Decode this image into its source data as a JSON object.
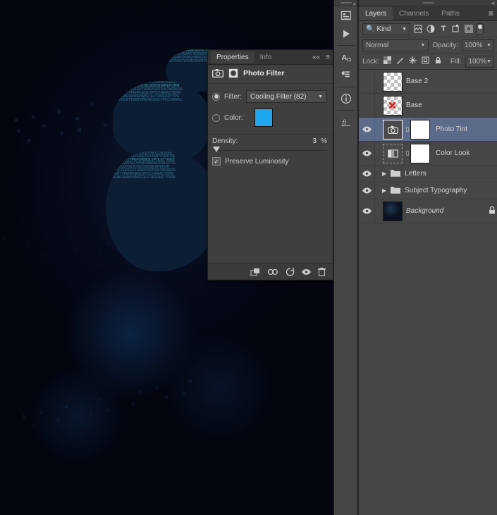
{
  "properties": {
    "tabs": {
      "properties": "Properties",
      "info": "Info"
    },
    "title": "Photo Filter",
    "filter_label": "Filter:",
    "filter_value": "Cooling Filter (82)",
    "color_label": "Color:",
    "color_hex": "#1fa6ef",
    "density_label": "Density:",
    "density_value": "3",
    "density_unit": "%",
    "preserve_label": "Preserve Luminosity",
    "preserve_checked": true,
    "radio_selected": "filter"
  },
  "layers_panel": {
    "tabs": {
      "layers": "Layers",
      "channels": "Channels",
      "paths": "Paths"
    },
    "kind_label": "Kind",
    "blend_mode": "Normal",
    "opacity_label": "Opacity:",
    "opacity_value": "100%",
    "lock_label": "Lock:",
    "fill_label": "Fill:",
    "fill_value": "100%",
    "search_icon": "🔍"
  },
  "layers": [
    {
      "name": "Base 2",
      "type": "raster",
      "visible": false,
      "thumb": "checker",
      "mark": ""
    },
    {
      "name": "Base",
      "type": "raster",
      "visible": false,
      "thumb": "checker",
      "mark": "red"
    },
    {
      "name": "Photo Tint",
      "type": "adjust",
      "visible": true,
      "selected": true,
      "mask": true
    },
    {
      "name": "Color Look",
      "type": "adjust",
      "visible": true,
      "selected": false,
      "mask": true
    },
    {
      "name": "Letters",
      "type": "group",
      "visible": true
    },
    {
      "name": "Subject Typography",
      "type": "group",
      "visible": true
    },
    {
      "name": "Background",
      "type": "raster",
      "visible": true,
      "thumb": "bg",
      "locked": true,
      "italic": true
    }
  ]
}
